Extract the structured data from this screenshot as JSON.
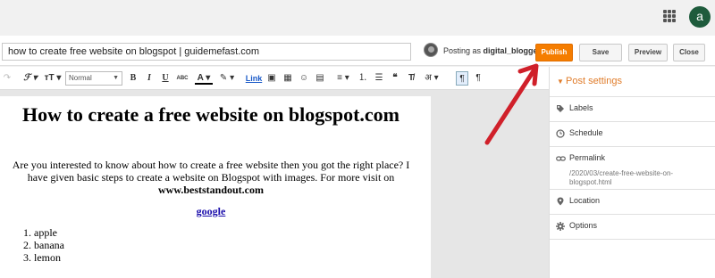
{
  "account": {
    "avatar_letter": "a"
  },
  "post": {
    "title_value": "how to create free website on blogspot | guidemefast.com",
    "posting_as_prefix": "Posting as ",
    "author": "digital_blogger"
  },
  "actions": {
    "publish": "Publish",
    "save": "Save",
    "preview": "Preview",
    "close": "Close"
  },
  "toolbar": {
    "undo": "↷",
    "font": "ℱ ▾",
    "size": "ᴛT ▾",
    "format_value": "Normal",
    "bold": "B",
    "italic": "I",
    "underline": "U",
    "strike": "ABC",
    "text_color": "A ▾",
    "highlight": "✎ ▾",
    "link": "Link",
    "image": "▣",
    "video": "▦",
    "emoji": "☺",
    "jump_break": "▤",
    "align": "≡ ▾",
    "numbered_list": "⒈",
    "bullet_list": "☰",
    "quote": "❝",
    "clear_format": "T̸",
    "language": "अ ▾",
    "ltr": "¶",
    "rtl": "¶"
  },
  "content": {
    "heading": "How to create a free website on blogspot.com",
    "intro": "Are you interested to know about how to create a free website then you got the right place? I have given basic steps to create a website on Blogspot with images. For more visit on ",
    "intro_site": "www.beststandout.com",
    "link_text": "google",
    "list_items": [
      "apple",
      "banana",
      "lemon"
    ]
  },
  "post_settings": {
    "title": "Post settings",
    "labels": "Labels",
    "schedule": "Schedule",
    "permalink": "Permalink",
    "permalink_value": "/2020/03/create-free-website-on-blogspot.html",
    "location": "Location",
    "options": "Options"
  },
  "colors": {
    "publish": "#f57d00",
    "accent": "#e07c2a",
    "annotation_arrow": "#d0202a"
  }
}
